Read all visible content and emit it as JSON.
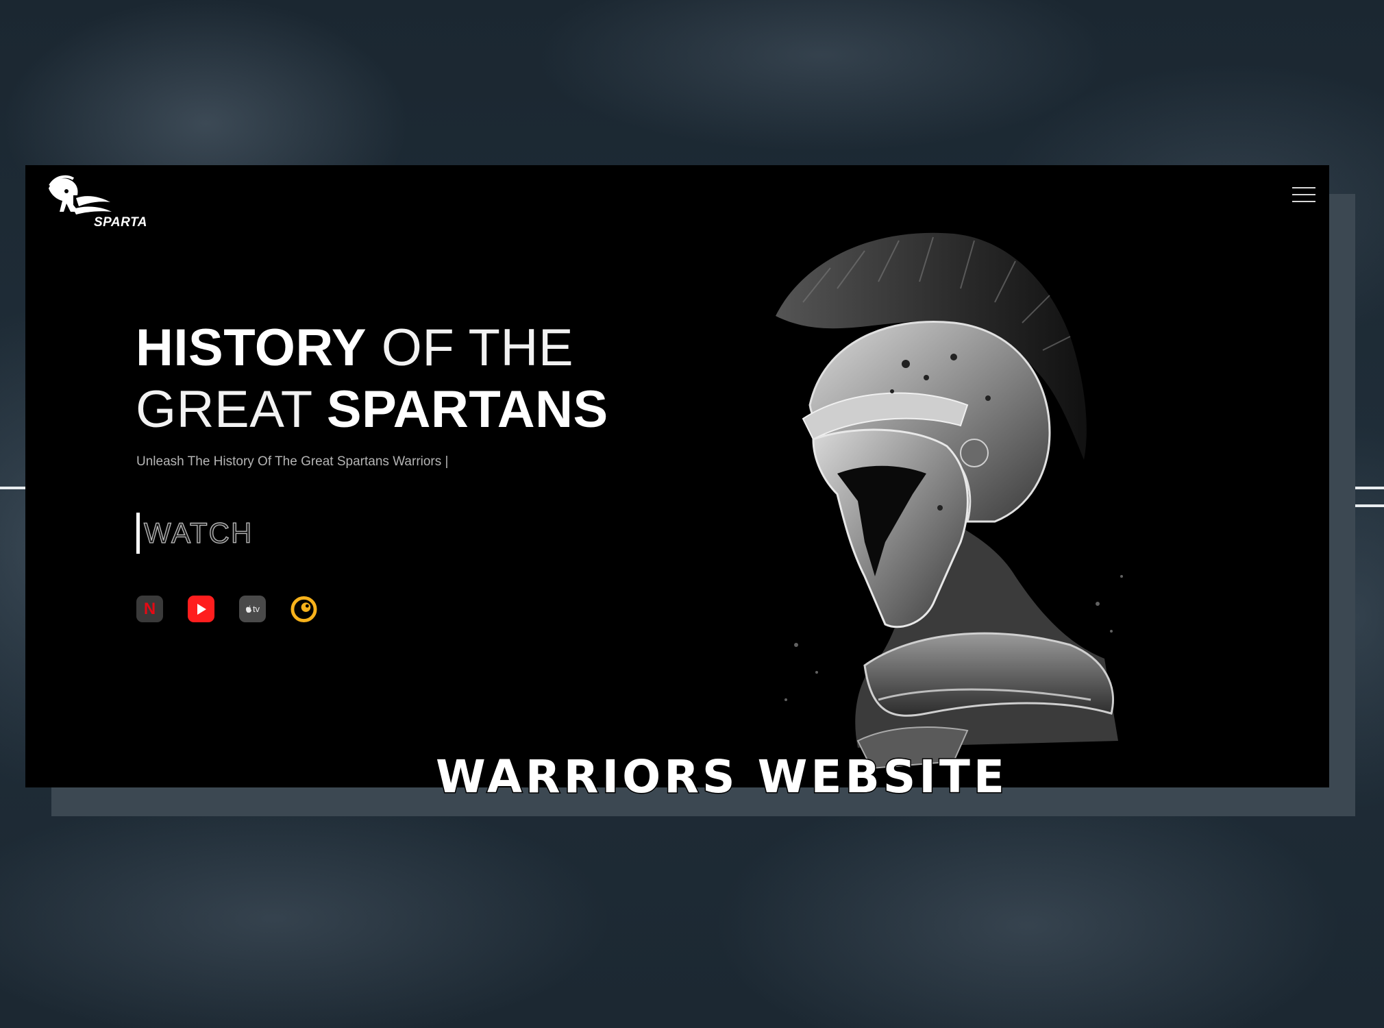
{
  "brand": {
    "name": "SPARTA"
  },
  "hero": {
    "line1_bold": "HISTORY",
    "line1_light": " OF THE",
    "line2_light": "GREAT ",
    "line2_bold": "SPARTANS",
    "subtitle": "Unleash The History Of The Great Spartans Warriors |",
    "cta_label": "WATCH"
  },
  "platforms": [
    {
      "name": "netflix-icon",
      "glyph": "N"
    },
    {
      "name": "youtube-icon"
    },
    {
      "name": "apple-tv-icon",
      "glyph": "tv"
    },
    {
      "name": "crunchyroll-icon"
    }
  ],
  "caption": "WARRIORS WEBSITE",
  "colors": {
    "backdrop": "#1a2530",
    "panel": "#000000",
    "accent_white": "#ffffff",
    "youtube_red": "#ff1e1e",
    "netflix_red": "#e50914",
    "crunchyroll_yellow": "#f7b21b"
  }
}
